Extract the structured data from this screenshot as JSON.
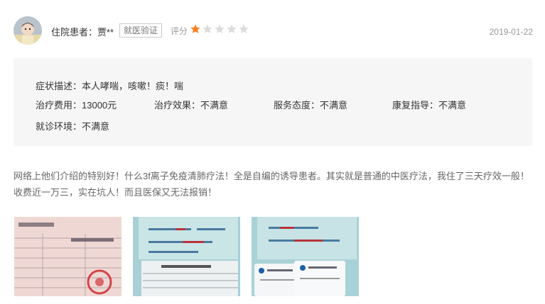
{
  "review_header": {
    "user_label": "住院患者：贾**",
    "verified_badge": "就医验证",
    "rating_label": "评分",
    "rating_value": 1,
    "rating_max": 5,
    "date": "2019-01-22"
  },
  "details": {
    "symptoms": "症状描述：本人哮喘，咳嗽！痰！喘",
    "cost": "治疗费用：13000元",
    "effect": "治疗效果：不满意",
    "service": "服务态度：不满意",
    "guidance": "康复指导：不满意",
    "environment": "就诊环境：不满意"
  },
  "review_text": "网络上他们介绍的特别好！什么3f离子免疫清肺疗法！全是自编的诱导患者。其实就是普通的中医疗法，我住了三天疗效一般！收费近一万三，实在坑人！而且医保又无法报销！",
  "colors": {
    "star_filled": "#ff7e1b",
    "star_empty": "#dcdcdc",
    "panel_bg": "#f6f6f6"
  },
  "photos": [
    {
      "icon": "receipt-photo"
    },
    {
      "icon": "medical-record-photo"
    },
    {
      "icon": "bank-card-photo"
    }
  ]
}
